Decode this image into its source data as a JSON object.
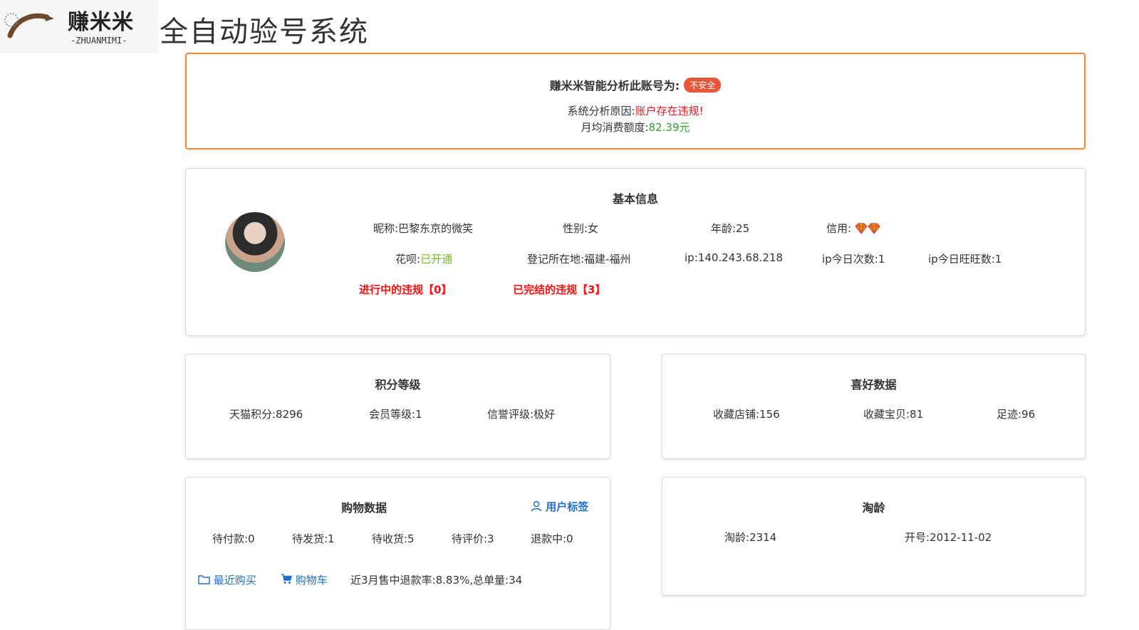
{
  "header": {
    "logo_text": "赚米米",
    "logo_subtext": "-ZHUANMIMI-",
    "system_title": "全自动验号系统"
  },
  "alert": {
    "heading": "赚米米智能分析此账号为:",
    "badge": "不安全",
    "reason_label": "系统分析原因:",
    "reason_value": "账户存在违规!",
    "monthly_label": "月均消费额度:",
    "monthly_value": "82.39元",
    "colors": {
      "border": "#ef8a3a",
      "badge": "#e8573a",
      "danger": "#e8121b",
      "good": "#2aa52a"
    }
  },
  "basic": {
    "title": "基本信息",
    "nickname": "昵称:巴黎东京的微笑",
    "gender": "性别:女",
    "age": "年龄:25",
    "credit_label": "信用:",
    "credit_icon": "diamond-icon",
    "credit_level": 2,
    "huabei_label": "花呗:",
    "huabei_value": "已开通",
    "location": "登记所在地:福建-福州",
    "ip": "ip:140.243.68.218",
    "ip_today": "ip今日次数:1",
    "ip_wangwang": "ip今日旺旺数:1",
    "violations_ongoing": "进行中的违规【0】",
    "violations_done": "已完结的违规【3】"
  },
  "points": {
    "title": "积分等级",
    "tmall": "天猫积分:8296",
    "member": "会员等级:1",
    "rating": "信誉评级:极好"
  },
  "prefs": {
    "title": "喜好数据",
    "shops": "收藏店铺:156",
    "items": "收藏宝贝:81",
    "footprint": "足迹:96"
  },
  "shopping": {
    "title": "购物数据",
    "tag_link": "用户标签",
    "pay": "待付款:0",
    "ship": "待发货:1",
    "receive": "待收货:5",
    "review": "待评价:3",
    "refund": "退款中:0",
    "recent_link": "最近购买",
    "cart_link": "购物车",
    "refund_rate": "近3月售中退款率:8.83%,总单量:34"
  },
  "age_card": {
    "title": "淘龄",
    "taoling": "淘龄:2314",
    "opened": "开号:2012-11-02"
  }
}
